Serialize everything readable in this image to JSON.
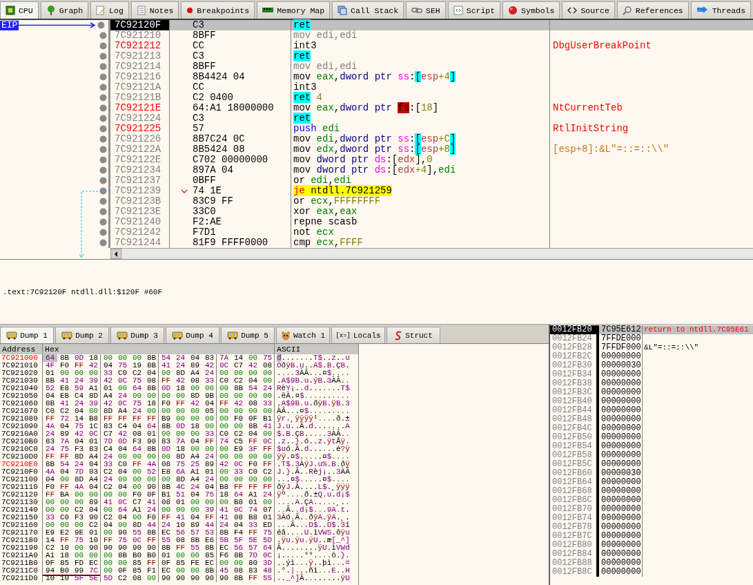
{
  "tabs": [
    {
      "label": "CPU",
      "selected": true
    },
    {
      "label": "Graph",
      "selected": false
    },
    {
      "label": "Log",
      "selected": false
    },
    {
      "label": "Notes",
      "selected": false
    },
    {
      "label": "Breakpoints",
      "selected": false
    },
    {
      "label": "Memory Map",
      "selected": false
    },
    {
      "label": "Call Stack",
      "selected": false
    },
    {
      "label": "SEH",
      "selected": false
    },
    {
      "label": "Script",
      "selected": false
    },
    {
      "label": "Symbols",
      "selected": false
    },
    {
      "label": "Source",
      "selected": false
    },
    {
      "label": "References",
      "selected": false
    },
    {
      "label": "Threads",
      "selected": false
    }
  ],
  "disassembly": {
    "eip_label": "EIP",
    "rows": [
      {
        "address": "7C92120F",
        "bytes": "C3",
        "selected": true,
        "labeled": false,
        "eip": true,
        "jump": false,
        "instruction": [
          {
            "text": "ret",
            "kind": "ret"
          }
        ]
      },
      {
        "address": "7C921210",
        "bytes": "8BFF",
        "selected": false,
        "labeled": false,
        "eip": false,
        "jump": false,
        "instruction": [
          {
            "text": "mov edi,edi",
            "kind": "faded"
          }
        ]
      },
      {
        "address": "7C921212",
        "bytes": "CC",
        "selected": false,
        "labeled": true,
        "eip": false,
        "jump": false,
        "instruction": [
          {
            "text": "int3",
            "kind": "op"
          }
        ],
        "comment": {
          "text": "DbgUserBreakPoint",
          "kind": "label"
        }
      },
      {
        "address": "7C921213",
        "bytes": "C3",
        "selected": false,
        "labeled": false,
        "eip": false,
        "jump": false,
        "instruction": [
          {
            "text": "ret",
            "kind": "ret"
          }
        ]
      },
      {
        "address": "7C921214",
        "bytes": "8BFF",
        "selected": false,
        "labeled": false,
        "eip": false,
        "jump": false,
        "instruction": [
          {
            "text": "mov edi,edi",
            "kind": "faded"
          }
        ]
      },
      {
        "address": "7C921216",
        "bytes": "8B4424 04",
        "selected": false,
        "labeled": false,
        "eip": false,
        "jump": false,
        "instruction": [
          {
            "text": "mov ",
            "kind": "op"
          },
          {
            "text": "eax",
            "kind": "reg"
          },
          {
            "text": ",",
            "kind": "punct"
          },
          {
            "text": "dword ptr ",
            "kind": "size"
          },
          {
            "text": "ss",
            "kind": "seg"
          },
          {
            "text": ":",
            "kind": "punct"
          },
          {
            "text": "[",
            "kind": "brack"
          },
          {
            "text": "esp",
            "kind": "mem"
          },
          {
            "text": "+4",
            "kind": "num"
          },
          {
            "text": "]",
            "kind": "brack"
          }
        ]
      },
      {
        "address": "7C92121A",
        "bytes": "CC",
        "selected": false,
        "labeled": false,
        "eip": false,
        "jump": false,
        "instruction": [
          {
            "text": "int3",
            "kind": "op"
          }
        ]
      },
      {
        "address": "7C92121B",
        "bytes": "C2 0400",
        "selected": false,
        "labeled": false,
        "eip": false,
        "jump": false,
        "instruction": [
          {
            "text": "ret",
            "kind": "ret"
          },
          {
            "text": " 4",
            "kind": "num"
          }
        ]
      },
      {
        "address": "7C92121E",
        "bytes": "64:A1 18000000",
        "selected": false,
        "labeled": true,
        "eip": false,
        "jump": false,
        "instruction": [
          {
            "text": "mov ",
            "kind": "op"
          },
          {
            "text": "eax",
            "kind": "reg"
          },
          {
            "text": ",",
            "kind": "punct"
          },
          {
            "text": "dword ptr ",
            "kind": "size"
          },
          {
            "text": "fs",
            "kind": "segwarn"
          },
          {
            "text": ":[",
            "kind": "punct"
          },
          {
            "text": "18",
            "kind": "num"
          },
          {
            "text": "]",
            "kind": "punct"
          }
        ],
        "comment": {
          "text": "NtCurrentTeb",
          "kind": "label"
        }
      },
      {
        "address": "7C921224",
        "bytes": "C3",
        "selected": false,
        "labeled": false,
        "eip": false,
        "jump": false,
        "instruction": [
          {
            "text": "ret",
            "kind": "ret"
          }
        ]
      },
      {
        "address": "7C921225",
        "bytes": "57",
        "selected": false,
        "labeled": true,
        "eip": false,
        "jump": false,
        "instruction": [
          {
            "text": "push ",
            "kind": "push"
          },
          {
            "text": "edi",
            "kind": "reg"
          }
        ],
        "comment": {
          "text": "RtlInitString",
          "kind": "label"
        }
      },
      {
        "address": "7C921226",
        "bytes": "8B7C24 0C",
        "selected": false,
        "labeled": false,
        "eip": false,
        "jump": false,
        "instruction": [
          {
            "text": "mov ",
            "kind": "op"
          },
          {
            "text": "edi",
            "kind": "reg"
          },
          {
            "text": ",",
            "kind": "punct"
          },
          {
            "text": "dword ptr ",
            "kind": "size"
          },
          {
            "text": "ss",
            "kind": "seg"
          },
          {
            "text": ":",
            "kind": "punct"
          },
          {
            "text": "[",
            "kind": "brack"
          },
          {
            "text": "esp",
            "kind": "mem"
          },
          {
            "text": "+C",
            "kind": "num"
          },
          {
            "text": "]",
            "kind": "brack"
          }
        ]
      },
      {
        "address": "7C92122A",
        "bytes": "8B5424 08",
        "selected": false,
        "labeled": false,
        "eip": false,
        "jump": false,
        "instruction": [
          {
            "text": "mov ",
            "kind": "op"
          },
          {
            "text": "edx",
            "kind": "reg"
          },
          {
            "text": ",",
            "kind": "punct"
          },
          {
            "text": "dword ptr ",
            "kind": "size"
          },
          {
            "text": "ss",
            "kind": "seg"
          },
          {
            "text": ":",
            "kind": "punct"
          },
          {
            "text": "[",
            "kind": "brack"
          },
          {
            "text": "esp",
            "kind": "mem"
          },
          {
            "text": "+8",
            "kind": "num"
          },
          {
            "text": "]",
            "kind": "brack"
          }
        ],
        "comment": {
          "text": "[esp+8]:&L\"=::=::\\\\\"",
          "kind": "string"
        }
      },
      {
        "address": "7C92122E",
        "bytes": "C702 00000000",
        "selected": false,
        "labeled": false,
        "eip": false,
        "jump": false,
        "instruction": [
          {
            "text": "mov ",
            "kind": "op"
          },
          {
            "text": "dword ptr ",
            "kind": "size"
          },
          {
            "text": "ds",
            "kind": "seg"
          },
          {
            "text": ":[",
            "kind": "punct"
          },
          {
            "text": "edx",
            "kind": "mem"
          },
          {
            "text": "],",
            "kind": "punct"
          },
          {
            "text": "0",
            "kind": "num"
          }
        ]
      },
      {
        "address": "7C921234",
        "bytes": "897A 04",
        "selected": false,
        "labeled": false,
        "eip": false,
        "jump": false,
        "instruction": [
          {
            "text": "mov ",
            "kind": "op"
          },
          {
            "text": "dword ptr ",
            "kind": "size"
          },
          {
            "text": "ds",
            "kind": "seg"
          },
          {
            "text": ":[",
            "kind": "punct"
          },
          {
            "text": "edx",
            "kind": "mem"
          },
          {
            "text": "+4",
            "kind": "num"
          },
          {
            "text": "],",
            "kind": "punct"
          },
          {
            "text": "edi",
            "kind": "reg"
          }
        ]
      },
      {
        "address": "7C921237",
        "bytes": "0BFF",
        "selected": false,
        "labeled": false,
        "eip": false,
        "jump": false,
        "instruction": [
          {
            "text": "or ",
            "kind": "op"
          },
          {
            "text": "edi",
            "kind": "reg"
          },
          {
            "text": ",",
            "kind": "punct"
          },
          {
            "text": "edi",
            "kind": "reg"
          }
        ]
      },
      {
        "address": "7C921239",
        "bytes": "74 1E",
        "selected": false,
        "labeled": false,
        "eip": false,
        "jump": true,
        "instruction": [
          {
            "text": "je",
            "kind": "jmp"
          },
          {
            "text": " ntdll.7C921259",
            "kind": "target"
          }
        ]
      },
      {
        "address": "7C92123B",
        "bytes": "83C9 FF",
        "selected": false,
        "labeled": false,
        "eip": false,
        "jump": false,
        "instruction": [
          {
            "text": "or ",
            "kind": "op"
          },
          {
            "text": "ecx",
            "kind": "reg"
          },
          {
            "text": ",",
            "kind": "punct"
          },
          {
            "text": "FFFFFFFF",
            "kind": "num"
          }
        ]
      },
      {
        "address": "7C92123E",
        "bytes": "33C0",
        "selected": false,
        "labeled": false,
        "eip": false,
        "jump": false,
        "instruction": [
          {
            "text": "xor ",
            "kind": "op"
          },
          {
            "text": "eax",
            "kind": "reg"
          },
          {
            "text": ",",
            "kind": "punct"
          },
          {
            "text": "eax",
            "kind": "reg"
          }
        ]
      },
      {
        "address": "7C921240",
        "bytes": "F2:AE",
        "selected": false,
        "labeled": false,
        "eip": false,
        "jump": false,
        "instruction": [
          {
            "text": "repne scasb",
            "kind": "op"
          }
        ]
      },
      {
        "address": "7C921242",
        "bytes": "F7D1",
        "selected": false,
        "labeled": false,
        "eip": false,
        "jump": false,
        "instruction": [
          {
            "text": "not ",
            "kind": "op"
          },
          {
            "text": "ecx",
            "kind": "reg"
          }
        ]
      },
      {
        "address": "7C921244",
        "bytes": "81F9 FFFF0000",
        "selected": false,
        "labeled": false,
        "eip": false,
        "jump": false,
        "instruction": [
          {
            "text": "cmp ",
            "kind": "op"
          },
          {
            "text": "ecx",
            "kind": "reg"
          },
          {
            "text": ",",
            "kind": "punct"
          },
          {
            "text": "FFFF",
            "kind": "num"
          }
        ]
      }
    ]
  },
  "info_line": ".text:7C92120F ntdll.dll:$120F #60F",
  "dump_tabs": [
    {
      "label": "Dump 1",
      "kind": "dump",
      "selected": true
    },
    {
      "label": "Dump 2",
      "kind": "dump",
      "selected": false
    },
    {
      "label": "Dump 3",
      "kind": "dump",
      "selected": false
    },
    {
      "label": "Dump 4",
      "kind": "dump",
      "selected": false
    },
    {
      "label": "Dump 5",
      "kind": "dump",
      "selected": false
    },
    {
      "label": "Watch 1",
      "kind": "watch",
      "selected": false
    },
    {
      "label": "Locals",
      "kind": "locals",
      "glyph": "[x=]",
      "selected": false
    },
    {
      "label": "Struct",
      "kind": "struct",
      "selected": false
    }
  ],
  "dump": {
    "columns": [
      "Address",
      "Hex",
      "ASCII"
    ],
    "rows": [
      {
        "address": "7C921000",
        "labeled": true,
        "cursor": true,
        "underline": false,
        "bytes": [
          "64",
          "8B",
          "0D",
          "18",
          "00",
          "00",
          "00",
          "8B",
          "54",
          "24",
          "04",
          "83",
          "7A",
          "14",
          "00",
          "75"
        ],
        "ascii": "d.......T$..z..u"
      },
      {
        "address": "7C921010",
        "labeled": false,
        "cursor": false,
        "underline": false,
        "bytes": [
          "4F",
          "F0",
          "FF",
          "42",
          "04",
          "75",
          "19",
          "8B",
          "41",
          "24",
          "89",
          "42",
          "0C",
          "C7",
          "42",
          "08"
        ],
        "ascii": "OðÿB.u..A$.B.ÇB."
      },
      {
        "address": "7C921020",
        "labeled": false,
        "cursor": false,
        "underline": false,
        "bytes": [
          "01",
          "00",
          "00",
          "00",
          "33",
          "C0",
          "C2",
          "04",
          "00",
          "8D",
          "A4",
          "24",
          "00",
          "00",
          "00",
          "00"
        ],
        "ascii": "....3ÀÂ...¤$...."
      },
      {
        "address": "7C921030",
        "labeled": false,
        "cursor": false,
        "underline": false,
        "bytes": [
          "8B",
          "41",
          "24",
          "39",
          "42",
          "0C",
          "75",
          "08",
          "FF",
          "42",
          "08",
          "33",
          "C0",
          "C2",
          "04",
          "00"
        ],
        "ascii": ".A$9B.u.ÿB.3ÀÂ.."
      },
      {
        "address": "7C921040",
        "labeled": false,
        "cursor": false,
        "underline": false,
        "bytes": [
          "52",
          "E8",
          "59",
          "A1",
          "01",
          "00",
          "64",
          "8B",
          "0D",
          "18",
          "00",
          "00",
          "00",
          "8B",
          "54",
          "24"
        ],
        "ascii": "RèY¡..d.......T$"
      },
      {
        "address": "7C921050",
        "labeled": false,
        "cursor": false,
        "underline": false,
        "bytes": [
          "04",
          "EB",
          "C4",
          "8D",
          "A4",
          "24",
          "00",
          "00",
          "00",
          "00",
          "8D",
          "9B",
          "00",
          "00",
          "00",
          "00"
        ],
        "ascii": ".ëÄ.¤$.........."
      },
      {
        "address": "7C921060",
        "labeled": false,
        "cursor": false,
        "underline": false,
        "bytes": [
          "8B",
          "41",
          "24",
          "39",
          "42",
          "0C",
          "75",
          "18",
          "F0",
          "FF",
          "42",
          "04",
          "FF",
          "42",
          "08",
          "33"
        ],
        "ascii": ".A$9B.u.ðÿB.ÿB.3"
      },
      {
        "address": "7C921070",
        "labeled": false,
        "cursor": false,
        "underline": false,
        "bytes": [
          "C0",
          "C2",
          "04",
          "00",
          "8D",
          "A4",
          "24",
          "00",
          "00",
          "00",
          "00",
          "05",
          "00",
          "00",
          "00",
          "00"
        ],
        "ascii": "ÀÂ...¤$........."
      },
      {
        "address": "7C921080",
        "labeled": false,
        "cursor": false,
        "underline": false,
        "bytes": [
          "FF",
          "72",
          "14",
          "B8",
          "FF",
          "FF",
          "FF",
          "FF",
          "B9",
          "00",
          "00",
          "00",
          "00",
          "F0",
          "0F",
          "B1"
        ],
        "ascii": "ÿr.¸ÿÿÿÿ¹....ð.±"
      },
      {
        "address": "7C921090",
        "labeled": false,
        "cursor": false,
        "underline": false,
        "bytes": [
          "4A",
          "04",
          "75",
          "1C",
          "83",
          "C4",
          "04",
          "64",
          "8B",
          "0D",
          "18",
          "00",
          "00",
          "00",
          "8B",
          "41"
        ],
        "ascii": "J.u..Ä.d.......A"
      },
      {
        "address": "7C9210A0",
        "labeled": false,
        "cursor": false,
        "underline": false,
        "bytes": [
          "24",
          "89",
          "42",
          "0C",
          "C7",
          "42",
          "08",
          "01",
          "00",
          "00",
          "00",
          "33",
          "C0",
          "C2",
          "04",
          "00"
        ],
        "ascii": "$.B.ÇB.....3ÀÂ.."
      },
      {
        "address": "7C9210B0",
        "labeled": false,
        "cursor": false,
        "underline": false,
        "bytes": [
          "83",
          "7A",
          "04",
          "01",
          "7D",
          "0D",
          "F3",
          "90",
          "83",
          "7A",
          "04",
          "FF",
          "74",
          "C5",
          "FF",
          "0C"
        ],
        "ascii": ".z..}.ó..z.ÿtÅÿ."
      },
      {
        "address": "7C9210C0",
        "labeled": false,
        "cursor": false,
        "underline": false,
        "bytes": [
          "24",
          "75",
          "F3",
          "83",
          "C4",
          "04",
          "64",
          "8B",
          "0D",
          "18",
          "00",
          "00",
          "00",
          "E9",
          "3F",
          "FF"
        ],
        "ascii": "$uó.Ä.d......é?ÿ"
      },
      {
        "address": "7C9210D0",
        "labeled": false,
        "cursor": false,
        "underline": false,
        "bytes": [
          "FF",
          "FF",
          "8D",
          "A4",
          "24",
          "00",
          "00",
          "00",
          "00",
          "8D",
          "A4",
          "24",
          "00",
          "00",
          "00",
          "00"
        ],
        "ascii": "ÿÿ.¤$.....¤$...."
      },
      {
        "address": "7C9210E0",
        "labeled": true,
        "cursor": false,
        "underline": false,
        "bytes": [
          "8B",
          "54",
          "24",
          "04",
          "33",
          "C0",
          "FF",
          "4A",
          "08",
          "75",
          "25",
          "89",
          "42",
          "0C",
          "F0",
          "FF"
        ],
        "ascii": ".T$.3ÀÿJ.u%.B.ðÿ"
      },
      {
        "address": "7C9210F0",
        "labeled": false,
        "cursor": false,
        "underline": false,
        "bytes": [
          "4A",
          "04",
          "7D",
          "03",
          "C2",
          "04",
          "00",
          "52",
          "E8",
          "6A",
          "A1",
          "01",
          "00",
          "33",
          "C0",
          "C2"
        ],
        "ascii": "J.}.Â..Rèj¡..3ÀÂ"
      },
      {
        "address": "7C921100",
        "labeled": false,
        "cursor": false,
        "underline": false,
        "bytes": [
          "04",
          "00",
          "8D",
          "A4",
          "24",
          "00",
          "00",
          "00",
          "00",
          "8D",
          "A4",
          "24",
          "00",
          "00",
          "00",
          "00"
        ],
        "ascii": "...¤$.....¤$...."
      },
      {
        "address": "7C921110",
        "labeled": false,
        "cursor": false,
        "underline": false,
        "bytes": [
          "F0",
          "FF",
          "4A",
          "04",
          "C2",
          "04",
          "00",
          "90",
          "8B",
          "4C",
          "24",
          "04",
          "B8",
          "FF",
          "FF",
          "FF"
        ],
        "ascii": "ðÿJ.Â....L$.¸ÿÿÿ"
      },
      {
        "address": "7C921120",
        "labeled": false,
        "cursor": false,
        "underline": false,
        "bytes": [
          "FF",
          "BA",
          "00",
          "00",
          "00",
          "00",
          "F0",
          "0F",
          "B1",
          "51",
          "04",
          "75",
          "18",
          "64",
          "A1",
          "24"
        ],
        "ascii": "ÿº....ð.±Q.u.d¡$"
      },
      {
        "address": "7C921130",
        "labeled": false,
        "cursor": false,
        "underline": false,
        "bytes": [
          "00",
          "00",
          "00",
          "89",
          "41",
          "0C",
          "C7",
          "41",
          "08",
          "01",
          "00",
          "00",
          "00",
          "B8",
          "01",
          "00"
        ],
        "ascii": "....A.ÇA.....¸.."
      },
      {
        "address": "7C921140",
        "labeled": false,
        "cursor": false,
        "underline": false,
        "bytes": [
          "00",
          "00",
          "C2",
          "04",
          "00",
          "64",
          "A1",
          "24",
          "00",
          "00",
          "00",
          "39",
          "41",
          "0C",
          "74",
          "07"
        ],
        "ascii": "..Â..d¡$...9A.t."
      },
      {
        "address": "7C921150",
        "labeled": false,
        "cursor": false,
        "underline": false,
        "bytes": [
          "33",
          "C0",
          "F3",
          "90",
          "C2",
          "04",
          "00",
          "F0",
          "FF",
          "41",
          "04",
          "FF",
          "41",
          "08",
          "B8",
          "01"
        ],
        "ascii": "3Àó.Â..ðÿA.ÿA.¸."
      },
      {
        "address": "7C921160",
        "labeled": false,
        "cursor": false,
        "underline": false,
        "bytes": [
          "00",
          "00",
          "00",
          "C2",
          "04",
          "00",
          "8D",
          "44",
          "24",
          "10",
          "89",
          "44",
          "24",
          "04",
          "33",
          "ED"
        ],
        "ascii": "...Â...D$..D$.3í"
      },
      {
        "address": "7C921170",
        "labeled": false,
        "cursor": false,
        "underline": false,
        "bytes": [
          "E9",
          "E2",
          "9E",
          "01",
          "00",
          "90",
          "55",
          "8B",
          "EC",
          "56",
          "57",
          "53",
          "8B",
          "F4",
          "FF",
          "75"
        ],
        "ascii": "éâ....U.ìVWS.ôÿu"
      },
      {
        "address": "7C921180",
        "labeled": false,
        "cursor": false,
        "underline": false,
        "bytes": [
          "14",
          "FF",
          "75",
          "10",
          "FF",
          "75",
          "0C",
          "FF",
          "55",
          "08",
          "8B",
          "E6",
          "5B",
          "5F",
          "5E",
          "5D"
        ],
        "ascii": ".ÿu.ÿu.ÿU..æ[_^]"
      },
      {
        "address": "7C921190",
        "labeled": false,
        "cursor": false,
        "underline": false,
        "bytes": [
          "C2",
          "10",
          "00",
          "90",
          "90",
          "90",
          "90",
          "90",
          "8B",
          "FF",
          "55",
          "8B",
          "EC",
          "56",
          "57",
          "64"
        ],
        "ascii": "Â........ÿU.ìVWd"
      },
      {
        "address": "7C9211A0",
        "labeled": false,
        "cursor": false,
        "underline": false,
        "bytes": [
          "A1",
          "18",
          "00",
          "00",
          "00",
          "8B",
          "B0",
          "B0",
          "01",
          "00",
          "00",
          "85",
          "F6",
          "8B",
          "7D",
          "0C"
        ],
        "ascii": "¡.....°°....ö.}."
      },
      {
        "address": "7C9211B0",
        "labeled": false,
        "cursor": false,
        "underline": false,
        "bytes": [
          "0F",
          "85",
          "FD",
          "EC",
          "00",
          "00",
          "85",
          "FF",
          "0F",
          "85",
          "FE",
          "EC",
          "00",
          "00",
          "80",
          "3D"
        ],
        "ascii": "..ýì...ÿ..þì...="
      },
      {
        "address": "7C9211C0",
        "labeled": false,
        "cursor": false,
        "underline": true,
        "bytes": [
          "94",
          "B0",
          "99",
          "7C",
          "00",
          "0F",
          "85",
          "F1",
          "EC",
          "00",
          "00",
          "8B",
          "45",
          "08",
          "83",
          "48"
        ],
        "ascii": ".°.|...ñì...E..H"
      },
      {
        "address": "7C9211D0",
        "labeled": false,
        "cursor": false,
        "underline": false,
        "bytes": [
          "10",
          "10",
          "5F",
          "5E",
          "5D",
          "C2",
          "08",
          "00",
          "90",
          "90",
          "90",
          "90",
          "90",
          "8B",
          "FF",
          "55"
        ],
        "ascii": ".._^]Â........ÿU"
      }
    ]
  },
  "stack": [
    {
      "address": "0012FB20",
      "value": "7C95E612",
      "selected": true,
      "comment": {
        "text": "return to ntdll.7C95E61",
        "kind": "return"
      }
    },
    {
      "address": "0012FB24",
      "value": "7FFDE000",
      "selected": false
    },
    {
      "address": "0012FB28",
      "value": "7FFDF000",
      "selected": false,
      "comment": {
        "text": "&L\"=::=::\\\\\"",
        "kind": "string"
      }
    },
    {
      "address": "0012FB2C",
      "value": "00000000",
      "selected": false
    },
    {
      "address": "0012FB30",
      "value": "00000030",
      "selected": false
    },
    {
      "address": "0012FB34",
      "value": "00000000",
      "selected": false
    },
    {
      "address": "0012FB38",
      "value": "00000000",
      "selected": false
    },
    {
      "address": "0012FB3C",
      "value": "00000000",
      "selected": false
    },
    {
      "address": "0012FB40",
      "value": "00000000",
      "selected": false
    },
    {
      "address": "0012FB44",
      "value": "00000000",
      "selected": false
    },
    {
      "address": "0012FB48",
      "value": "00000000",
      "selected": false
    },
    {
      "address": "0012FB4C",
      "value": "00000000",
      "selected": false
    },
    {
      "address": "0012FB50",
      "value": "00000000",
      "selected": false
    },
    {
      "address": "0012FB54",
      "value": "00000000",
      "selected": false
    },
    {
      "address": "0012FB58",
      "value": "00000000",
      "selected": false
    },
    {
      "address": "0012FB5C",
      "value": "00000000",
      "selected": false
    },
    {
      "address": "0012FB60",
      "value": "00000030",
      "selected": false
    },
    {
      "address": "0012FB64",
      "value": "00000000",
      "selected": false
    },
    {
      "address": "0012FB68",
      "value": "00000000",
      "selected": false
    },
    {
      "address": "0012FB6C",
      "value": "00000000",
      "selected": false
    },
    {
      "address": "0012FB70",
      "value": "00000000",
      "selected": false
    },
    {
      "address": "0012FB74",
      "value": "00000000",
      "selected": false
    },
    {
      "address": "0012FB78",
      "value": "00000000",
      "selected": false
    },
    {
      "address": "0012FB7C",
      "value": "00000000",
      "selected": false
    },
    {
      "address": "0012FB80",
      "value": "00000000",
      "selected": false
    },
    {
      "address": "0012FB84",
      "value": "00000000",
      "selected": false
    },
    {
      "address": "0012FB88",
      "value": "00000000",
      "selected": false
    },
    {
      "address": "0012FB8C",
      "value": "00000000",
      "selected": false
    }
  ]
}
